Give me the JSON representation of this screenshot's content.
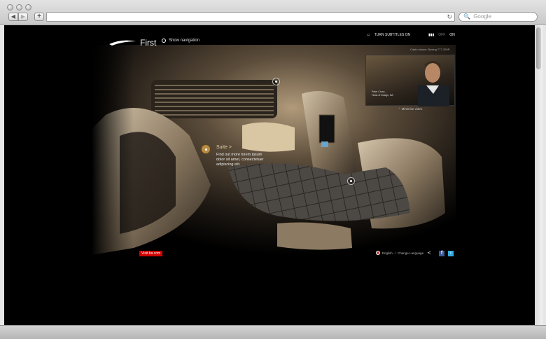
{
  "browser": {
    "back_label": "◀",
    "forward_label": "▶",
    "add_label": "+",
    "search_placeholder": "Google",
    "search_icon": "🔍",
    "reload_icon": "↻"
  },
  "header": {
    "brand": "First",
    "show_navigation": "Show navigation",
    "subtitles": "TURN SUBTITLES ON",
    "on_label": "ON",
    "off_label": "OFF",
    "cabin_shown": "Cabin shown: Boeing 777-300R"
  },
  "video": {
    "caption_line1": "Peter Cross...",
    "caption_line2": "Head of Design, BA",
    "minimise": "Minimise video"
  },
  "hotspot": {
    "title": "Suite",
    "chevron": ">",
    "text": "Find out more lorem ipsum dolor sit amet, consectetuer adipiscing elit."
  },
  "footer": {
    "visit": "Visit ba.com",
    "language": "English",
    "separator": "/",
    "change_language": "Change Language",
    "share_icon": "share-icon",
    "facebook": "f",
    "twitter": "t"
  }
}
